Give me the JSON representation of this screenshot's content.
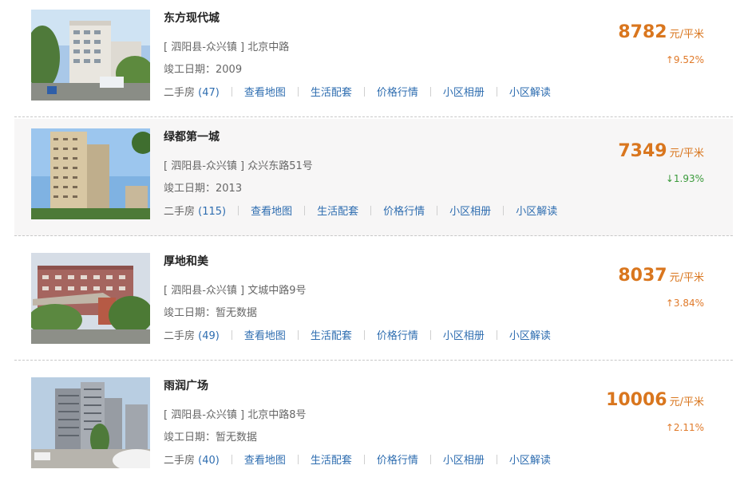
{
  "labels": {
    "unit": "元/平米",
    "secondhand": "二手房",
    "map": "查看地图",
    "amenities": "生活配套",
    "price_trend": "价格行情",
    "album": "小区相册",
    "analysis": "小区解读"
  },
  "listings": [
    {
      "name": "东方现代城",
      "address": "[ 泗阳县-众兴镇 ] 北京中路",
      "completion": "竣工日期：2009",
      "secondhand_count": "(47)",
      "price": "8782",
      "change": "↑9.52%",
      "direction": "up"
    },
    {
      "name": "绿都第一城",
      "address": "[ 泗阳县-众兴镇 ] 众兴东路51号",
      "completion": "竣工日期：2013",
      "secondhand_count": "(115)",
      "price": "7349",
      "change": "↓1.93%",
      "direction": "down"
    },
    {
      "name": "厚地和美",
      "address": "[ 泗阳县-众兴镇 ] 文城中路9号",
      "completion": "竣工日期：暂无数据",
      "secondhand_count": "(49)",
      "price": "8037",
      "change": "↑3.84%",
      "direction": "up"
    },
    {
      "name": "雨润广场",
      "address": "[ 泗阳县-众兴镇 ] 北京中路8号",
      "completion": "竣工日期：暂无数据",
      "secondhand_count": "(40)",
      "price": "10006",
      "change": "↑2.11%",
      "direction": "up"
    }
  ],
  "colors": {
    "price": "#d9761e",
    "up": "#e07a2a",
    "down": "#3a9a3a",
    "link": "#2e6db0"
  }
}
